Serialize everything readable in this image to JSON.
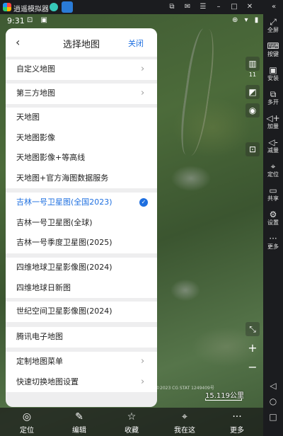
{
  "emulator": {
    "title": "逍遥模拟器",
    "controls": [
      "⧉",
      "✉",
      "☰",
      "–",
      "□",
      "✕"
    ],
    "expand": "«"
  },
  "side_toolbar": [
    {
      "icon": "⤢",
      "label": "全屏"
    },
    {
      "icon": "⌨",
      "label": "按键"
    },
    {
      "icon": "▣",
      "label": "安装"
    },
    {
      "icon": "⧉",
      "label": "多开"
    },
    {
      "icon": "◁+",
      "label": "加量"
    },
    {
      "icon": "◁-",
      "label": "减量"
    },
    {
      "icon": "⌖",
      "label": "定位"
    },
    {
      "icon": "▭",
      "label": "共享"
    },
    {
      "icon": "⚙",
      "label": "设置"
    },
    {
      "icon": "···",
      "label": "更多"
    }
  ],
  "system_nav": [
    "◁",
    "○",
    "□"
  ],
  "status": {
    "time": "9:31",
    "left_icons": "⊡ ▣",
    "right_icons": "⊕ ▾ ▮"
  },
  "map_tools": {
    "layers_icon": "▥",
    "layers_count": "11",
    "compass_icon": "◩",
    "camera_icon": "◉",
    "screenshot_icon": "⊡",
    "fullscreen_icon": "⤡",
    "zoom_in": "+",
    "zoom_out": "−"
  },
  "scale": {
    "label": "15.119公里"
  },
  "copyright": "©2023 CG STAT 1249409号",
  "bottom_nav": [
    {
      "icon": "◎",
      "label": "定位"
    },
    {
      "icon": "✎",
      "label": "编辑"
    },
    {
      "icon": "☆",
      "label": "收藏"
    },
    {
      "icon": "⌖",
      "label": "我在这"
    },
    {
      "icon": "···",
      "label": "更多"
    }
  ],
  "panel": {
    "back": "‹",
    "title": "选择地图",
    "close": "关闭",
    "chevron": "›",
    "check": "✓",
    "groups": [
      {
        "rows": [
          {
            "label": "自定义地图",
            "chevron": true
          }
        ]
      },
      {
        "rows": [
          {
            "label": "第三方地图",
            "chevron": true
          }
        ]
      },
      {
        "rows": [
          {
            "label": "天地图"
          },
          {
            "label": "天地图影像"
          },
          {
            "label": "天地图影像+等高线"
          },
          {
            "label": "天地图+官方海图数据服务"
          }
        ]
      },
      {
        "rows": [
          {
            "label": "吉林一号卫星图(全国2023)",
            "selected": true
          },
          {
            "label": "吉林一号卫星图(全球)"
          },
          {
            "label": "吉林一号季度卫星图(2025)"
          }
        ]
      },
      {
        "rows": [
          {
            "label": "四维地球卫星影像图(2024)"
          },
          {
            "label": "四维地球日新图"
          }
        ]
      },
      {
        "rows": [
          {
            "label": "世纪空间卫星影像图(2024)"
          }
        ]
      },
      {
        "rows": [
          {
            "label": "腾讯电子地图"
          }
        ]
      },
      {
        "rows": [
          {
            "label": "定制地图菜单",
            "chevron": true
          },
          {
            "label": "快速切换地图设置",
            "chevron": true
          }
        ]
      }
    ]
  }
}
